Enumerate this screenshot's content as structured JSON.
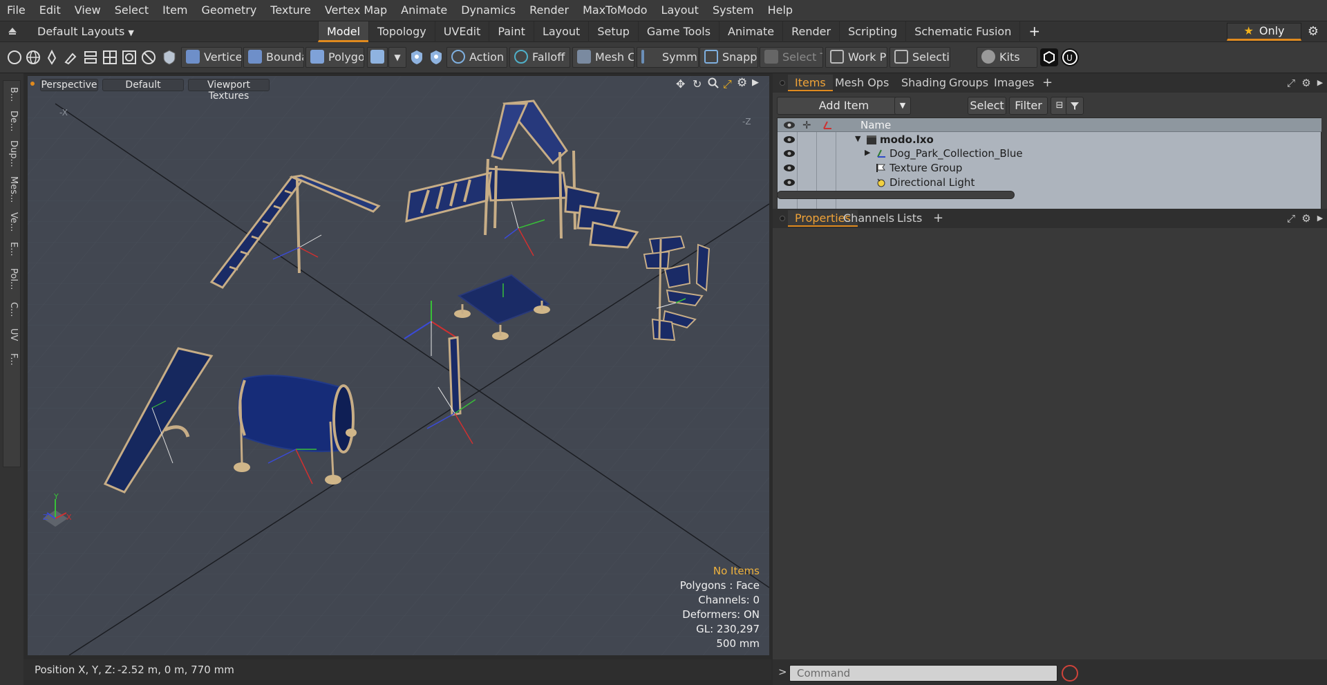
{
  "menu": [
    "File",
    "Edit",
    "View",
    "Select",
    "Item",
    "Geometry",
    "Texture",
    "Vertex Map",
    "Animate",
    "Dynamics",
    "Render",
    "MaxToModo",
    "Layout",
    "System",
    "Help"
  ],
  "layout_selector": "Default Layouts",
  "layout_tabs": [
    "Model",
    "Topology",
    "UVEdit",
    "Paint",
    "Layout",
    "Setup",
    "Game Tools",
    "Animate",
    "Render",
    "Scripting",
    "Schematic Fusion"
  ],
  "active_layout_tab": "Model",
  "only_button": "Only",
  "toolbar": {
    "vertices": "Vertices",
    "boundary": "Boundary",
    "polygons": "Polygons",
    "action": "Action",
    "action_more": "...",
    "falloff": "Falloff",
    "mesh_c": "Mesh C ...",
    "symm": "Symm ...",
    "snapping": "Snapping",
    "select_t": "Select T...",
    "work_pl": "Work Pl...",
    "selecti": "Selecti ...",
    "kits": "Kits"
  },
  "left_tabs": [
    "B...",
    "De...",
    "Dup...",
    "Mes...",
    "Ve...",
    "E...",
    "Pol...",
    "C...",
    "UV",
    "F..."
  ],
  "viewport": {
    "projection": "Perspective",
    "style": "Default",
    "shading": "Viewport Textures",
    "axis_labels": {
      "neg_x": "-X",
      "neg_z": "-Z"
    },
    "gizmo_labels": {
      "y": "Y",
      "x": "X",
      "z": "Z"
    },
    "info": {
      "selection": "No Items",
      "polygons": "Polygons : Face",
      "channels": "Channels: 0",
      "deformers": "Deformers: ON",
      "gl": "GL: 230,297",
      "grid": "500 mm"
    }
  },
  "status": {
    "label": "Position X, Y, Z:",
    "value": "-2.52 m, 0 m, 770 mm"
  },
  "items_panel": {
    "tabs": [
      "Items",
      "Mesh Ops",
      "Shading",
      "Groups",
      "Images"
    ],
    "active_tab": "Items",
    "add_item": "Add Item",
    "select": "Select",
    "filter": "Filter",
    "name_header": "Name",
    "items": [
      {
        "name": "modo.lxo",
        "bold": true
      },
      {
        "name": "Dog_Park_Collection_Blue",
        "bold": false
      },
      {
        "name": "Texture Group",
        "bold": false
      },
      {
        "name": "Directional Light",
        "bold": false
      }
    ]
  },
  "properties_panel": {
    "tabs": [
      "Properties",
      "Channels",
      "Lists"
    ],
    "active_tab": "Properties"
  },
  "command": {
    "placeholder": "Command",
    "prompt": ">"
  }
}
